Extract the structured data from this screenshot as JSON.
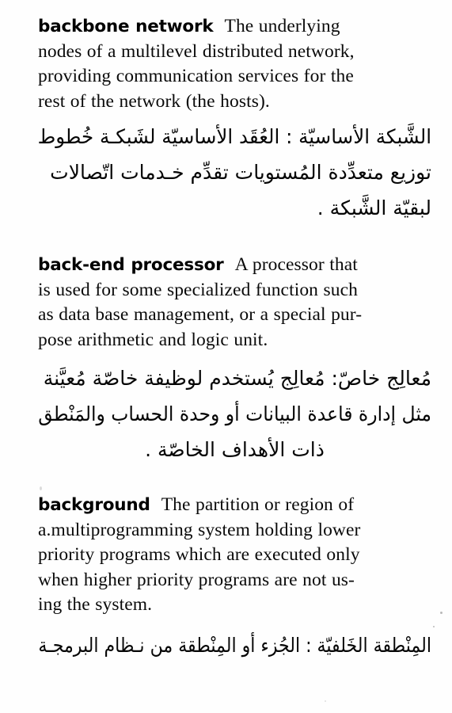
{
  "page": {
    "background_color": "#fefefe",
    "text_color": "#0a0a0a",
    "language_primary": "English",
    "language_secondary": "Arabic"
  },
  "entries": [
    {
      "headword": "backbone network",
      "english_lines": [
        "The underlying",
        "nodes of a multilevel distributed network,",
        "providing communication services for the",
        "rest of the network (the hosts)."
      ],
      "english_full": "backbone network The underlying nodes of a multilevel distributed network, providing communication services for the rest of the network (the hosts).",
      "arabic_lines": [
        "الشَّبكة الأساسيّة : العُقَد الأساسيّة لشَبكـة خُطوط",
        "توزيع متعدِّدة المُستويات تقدِّم خـدمات اتّصالات",
        "لبقيّة الشَّبكة ."
      ],
      "arabic_full": "الشَّبكة الأساسيّة : العُقَد الأساسيّة لشَبكة خُطوط توزيع متعدِّدة المُستويات تقدِّم خدمات اتّصالات لبقيّة الشَّبكة ."
    },
    {
      "headword": "back-end processor",
      "english_lines": [
        "A processor that",
        "is used for some specialized function such",
        "as data base management, or a special pur-",
        "pose arithmetic and logic unit."
      ],
      "english_full": "back-end processor A processor that is used for some specialized function such as data base management, or a special purpose arithmetic and logic unit.",
      "arabic_lines": [
        "مُعالِج خاصّ: مُعالِج يُستخدم لوظيفة خاصّة مُعيَّنة",
        "مثل إدارة قاعدة البيانات أو وحدة الحساب والمَنْطق",
        "ذات الأهداف الخاصّة ."
      ],
      "arabic_full": "مُعالِج خاصّ: مُعالِج يُستخدم لوظيفة خاصّة مُعيَّنة مثل إدارة قاعدة البيانات أو وحدة الحساب والمَنْطق ذات الأهداف الخاصّة ."
    },
    {
      "headword": "background",
      "english_lines": [
        "The partition or region of",
        "a.multiprogramming system holding lower",
        "priority programs which are executed only",
        "when higher priority programs are not us-",
        "ing the system."
      ],
      "english_full": "background The partition or region of a.multiprogramming system holding lower priority programs which are executed only when higher priority programs are not using the system.",
      "arabic_lines": [
        "المِنْطقة الخَلفيّة : الجُزء أو المِنْطقة من نـظام البرمجـة"
      ],
      "arabic_full": "المِنْطقة الخَلفيّة : الجُزء أو المِنْطقة من نـظام البرمجـة"
    }
  ]
}
